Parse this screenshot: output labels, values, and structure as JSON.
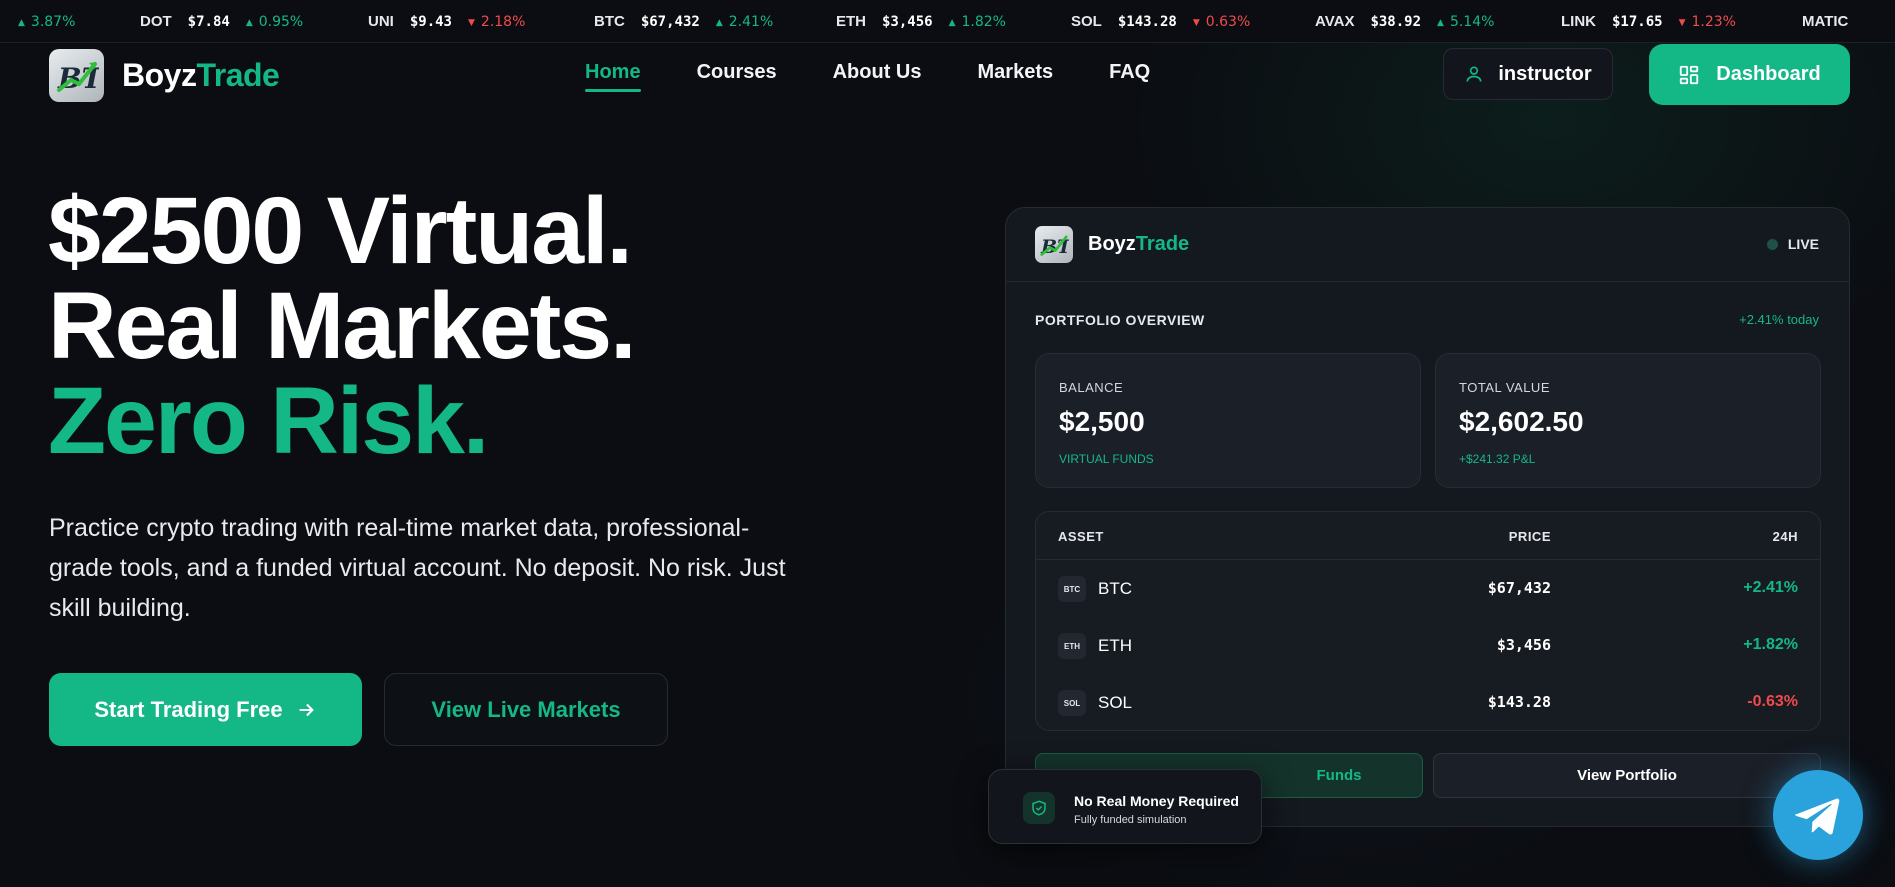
{
  "ticker": [
    {
      "symbol": "",
      "price": "",
      "change": "3.87%",
      "dir": "up"
    },
    {
      "symbol": "DOT",
      "price": "$7.84",
      "change": "0.95%",
      "dir": "up"
    },
    {
      "symbol": "UNI",
      "price": "$9.43",
      "change": "2.18%",
      "dir": "down"
    },
    {
      "symbol": "BTC",
      "price": "$67,432",
      "change": "2.41%",
      "dir": "up"
    },
    {
      "symbol": "ETH",
      "price": "$3,456",
      "change": "1.82%",
      "dir": "up"
    },
    {
      "symbol": "SOL",
      "price": "$143.28",
      "change": "0.63%",
      "dir": "down"
    },
    {
      "symbol": "AVAX",
      "price": "$38.92",
      "change": "5.14%",
      "dir": "up"
    },
    {
      "symbol": "LINK",
      "price": "$17.65",
      "change": "1.23%",
      "dir": "down"
    },
    {
      "symbol": "MATIC",
      "price": "",
      "change": "",
      "dir": "up"
    }
  ],
  "brand": {
    "part1": "Boyz",
    "part2": "Trade"
  },
  "nav": {
    "links": [
      "Home",
      "Courses",
      "About Us",
      "Markets",
      "FAQ"
    ],
    "active": "Home",
    "user_label": "instructor",
    "dashboard_label": "Dashboard"
  },
  "hero": {
    "line1": "$2500 Virtual.",
    "line2": "Real Markets.",
    "line3": "Zero Risk.",
    "subtitle": "Practice crypto trading with real-time market data, professional-grade tools, and a funded virtual account. No deposit. No risk. Just skill building.",
    "cta_primary": "Start Trading Free",
    "cta_secondary": "View Live Markets"
  },
  "card": {
    "live_label": "LIVE",
    "overview_title": "PORTFOLIO OVERVIEW",
    "today_change": "+2.41% today",
    "balance": {
      "label": "BALANCE",
      "value": "$2,500",
      "sub": "VIRTUAL FUNDS"
    },
    "total": {
      "label": "TOTAL VALUE",
      "value": "$2,602.50",
      "sub": "+$241.32 P&L"
    },
    "table": {
      "headers": [
        "ASSET",
        "PRICE",
        "24H"
      ],
      "rows": [
        {
          "badge": "BTC",
          "symbol": "BTC",
          "price": "$67,432",
          "change": "+2.41%",
          "dir": "up"
        },
        {
          "badge": "ETH",
          "symbol": "ETH",
          "price": "$3,456",
          "change": "+1.82%",
          "dir": "up"
        },
        {
          "badge": "SOL",
          "symbol": "SOL",
          "price": "$143.28",
          "change": "-0.63%",
          "dir": "down"
        }
      ]
    },
    "btn_funds": "Funds",
    "btn_portfolio": "View Portfolio"
  },
  "toast": {
    "title": "No Real Money Required",
    "subtitle": "Fully funded simulation"
  },
  "colors": {
    "accent": "#14b886",
    "negative": "#f04b4b",
    "background": "#0b0d12",
    "telegram": "#2aa3dd"
  },
  "icons": {
    "user": "user-icon",
    "dashboard": "grid-icon",
    "arrow": "arrow-right-icon",
    "shield": "shield-check-icon",
    "telegram": "telegram-icon"
  }
}
